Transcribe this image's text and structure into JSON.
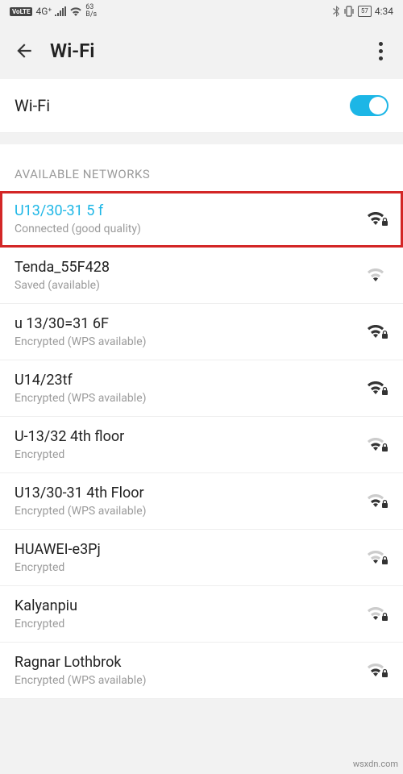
{
  "status_bar": {
    "volte": "VoLTE",
    "signal": "4G⁺",
    "rate_top": "63",
    "rate_bottom": "B/s",
    "battery": "57",
    "time": "4:34"
  },
  "header": {
    "title": "Wi-Fi"
  },
  "toggle": {
    "label": "Wi-Fi",
    "on": true
  },
  "section_label": "AVAILABLE NETWORKS",
  "networks": [
    {
      "name": "U13/30-31 5 f",
      "status": "Connected (good quality)",
      "connected": true,
      "highlighted": true,
      "strength": 3,
      "locked": true
    },
    {
      "name": "Tenda_55F428",
      "status": "Saved (available)",
      "connected": false,
      "highlighted": false,
      "strength": 1,
      "locked": false
    },
    {
      "name": "u 13/30=31 6F",
      "status": "Encrypted (WPS available)",
      "connected": false,
      "highlighted": false,
      "strength": 3,
      "locked": true
    },
    {
      "name": "U14/23tf",
      "status": "Encrypted (WPS available)",
      "connected": false,
      "highlighted": false,
      "strength": 3,
      "locked": true
    },
    {
      "name": "U-13/32 4th floor",
      "status": "Encrypted",
      "connected": false,
      "highlighted": false,
      "strength": 2,
      "locked": true
    },
    {
      "name": "U13/30-31 4th Floor",
      "status": "Encrypted (WPS available)",
      "connected": false,
      "highlighted": false,
      "strength": 2,
      "locked": true
    },
    {
      "name": "HUAWEI-e3Pj",
      "status": "Encrypted",
      "connected": false,
      "highlighted": false,
      "strength": 1,
      "locked": true
    },
    {
      "name": "Kalyanpiu",
      "status": "Encrypted",
      "connected": false,
      "highlighted": false,
      "strength": 1,
      "locked": true
    },
    {
      "name": "Ragnar Lothbrok",
      "status": "Encrypted (WPS available)",
      "connected": false,
      "highlighted": false,
      "strength": 2,
      "locked": true
    }
  ],
  "watermark": "wsxdn.com"
}
